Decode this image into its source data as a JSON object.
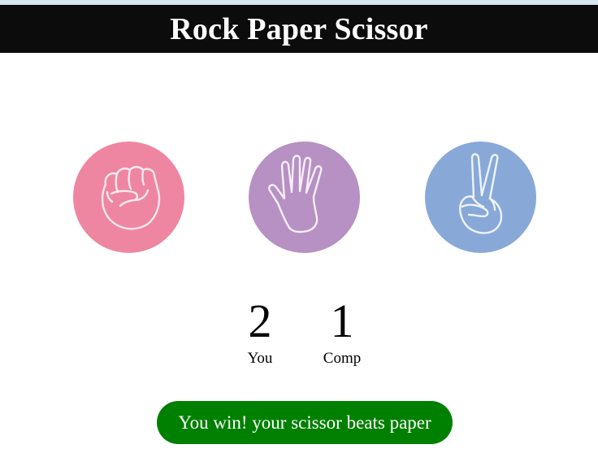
{
  "header": {
    "title": "Rock Paper Scissor",
    "background": "#0c0c0c"
  },
  "choices": [
    {
      "id": "rock",
      "icon": "fist-icon",
      "color": "#ef86a1"
    },
    {
      "id": "paper",
      "icon": "open-hand-icon",
      "color": "#b791c3"
    },
    {
      "id": "scissor",
      "icon": "peace-hand-icon",
      "color": "#88a9d8"
    }
  ],
  "scoreboard": {
    "user": {
      "score": "2",
      "label": "You"
    },
    "comp": {
      "score": "1",
      "label": "Comp"
    }
  },
  "result": {
    "message": "You win! your scissor beats paper",
    "color": "#008000"
  }
}
